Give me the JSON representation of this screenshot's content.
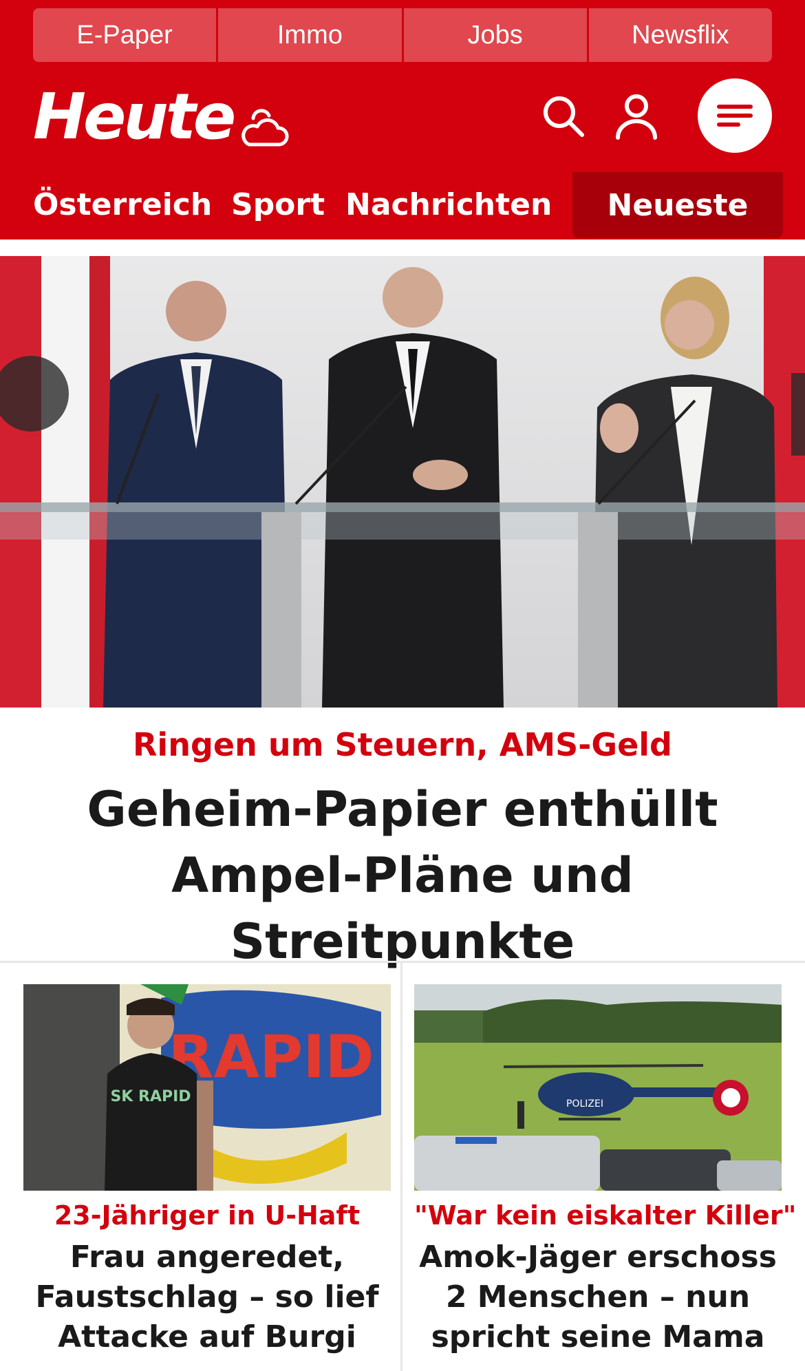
{
  "top_links": [
    "E-Paper",
    "Immo",
    "Jobs",
    "Newsflix"
  ],
  "brand": {
    "logo_text": "Heute",
    "color": "#d3000d"
  },
  "nav": {
    "items": [
      "Österreich",
      "Sport",
      "Nachrichten"
    ],
    "active": "Neueste"
  },
  "hero": {
    "kicker": "Ringen um Steuern, AMS-Geld",
    "headline": "Geheim-Papier enthüllt Ampel-Pläne und Streitpunkte"
  },
  "cards": [
    {
      "kicker": "23-Jähriger in U-Haft",
      "title": "Frau angeredet, Faustschlag – so lief Attacke auf Burgi",
      "image_text": "RAPID",
      "shirt_text": "SK RAPID"
    },
    {
      "kicker": "\"War kein eiskalter Killer\"",
      "title": "Amok-Jäger erschoss 2 Menschen – nun spricht seine Mama",
      "image_text": "POLIZEI"
    }
  ],
  "icons": [
    "weather-cloud-sun-icon",
    "search-icon",
    "user-icon",
    "menu-icon"
  ]
}
